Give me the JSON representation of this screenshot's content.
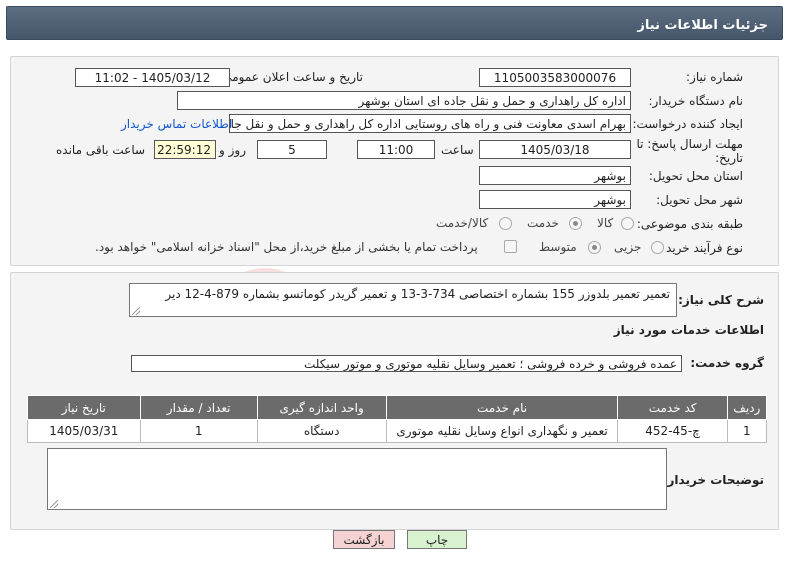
{
  "header": {
    "title": "جزئیات اطلاعات نیاز"
  },
  "fields": {
    "need_number_label": "شماره نیاز:",
    "need_number": "1105003583000076",
    "announce_label": "تاریخ و ساعت اعلان عمومی:",
    "announce_value": "1405/03/12 - 11:02",
    "buyer_org_label": "نام دستگاه خریدار:",
    "buyer_org": "اداره کل راهداری و حمل و نقل جاده ای استان بوشهر",
    "creator_label": "ایجاد کننده درخواست:",
    "creator": "بهرام اسدی معاونت فنی و راه های روستایی اداره کل راهداری و حمل و نقل جاده ای استان بوشهر",
    "contact_link": "اطلاعات تماس خریدار",
    "deadline_label": "مهلت ارسال پاسخ: تا تاریخ:",
    "deadline_date": "1405/03/18",
    "time_label": "ساعت",
    "deadline_time": "11:00",
    "days_value": "5",
    "days_label": "روز و",
    "remaining_time": "22:59:12",
    "remaining_label": "ساعت باقی مانده",
    "province_label": "استان محل تحویل:",
    "province": "بوشهر",
    "city_label": "شهر محل تحویل:",
    "city": "بوشهر",
    "category_label": "طبقه بندی موضوعی:",
    "category_options": [
      "کالا",
      "خدمت",
      "کالا/خدمت"
    ],
    "category_selected": "خدمت",
    "process_label": "نوع فرآیند خرید :",
    "process_options": [
      "جزیی",
      "متوسط"
    ],
    "process_selected": "متوسط",
    "payment_note": "پرداخت تمام یا بخشی از مبلغ خرید،از محل \"اسناد خزانه اسلامی\" خواهد بود."
  },
  "description": {
    "label": "شرح کلی نیاز:",
    "text": "تعمیر تعمیر بلدوزر 155 بشماره اختصاصی 734-3-13 و تعمیر گریدر کوماتسو بشماره 879-4-12 دیر"
  },
  "services": {
    "section_title": "اطلاعات خدمات مورد نیاز",
    "group_label": "گروه خدمت:",
    "group_value": "عمده فروشی و خرده فروشی ؛ تعمیر وسایل نقلیه موتوری و موتور سیکلت",
    "columns": [
      "ردیف",
      "کد خدمت",
      "نام خدمت",
      "واحد اندازه گیری",
      "تعداد / مقدار",
      "تاریخ نیاز"
    ],
    "rows": [
      {
        "row": "1",
        "code": "چ-45-452",
        "name": "تعمیر و نگهداری انواع وسایل نقلیه موتوری",
        "unit": "دستگاه",
        "qty": "1",
        "date": "1405/03/31"
      }
    ]
  },
  "buyer_notes": {
    "label": "توضیحات خریدار:",
    "text": ""
  },
  "buttons": {
    "print": "چاپ",
    "back": "بازگشت"
  },
  "watermark": {
    "text": "AriaTender.net"
  },
  "colors": {
    "header_bg": "#4f5f73",
    "link": "#1155cc",
    "back_btn_bg": "#f6d3d3",
    "print_btn_bg": "#d8f2d0",
    "yellow_field": "#fffdd6"
  }
}
